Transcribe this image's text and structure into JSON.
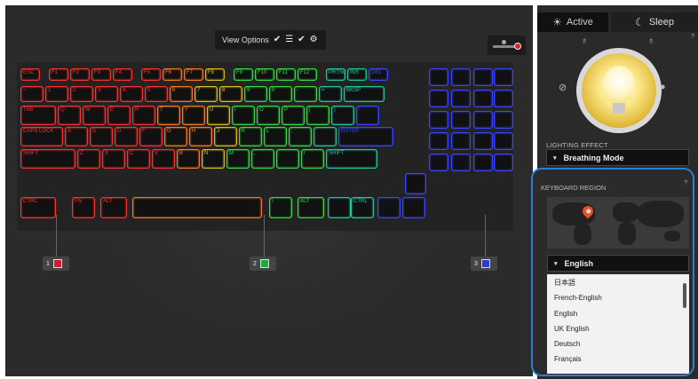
{
  "view_options": {
    "label": "View Options",
    "check1": "✔",
    "list_icon": "☰",
    "check2": "✔",
    "gear_icon": "⚙"
  },
  "tabs": {
    "active": "Active",
    "sleep": "Sleep",
    "sun_icon": "☀",
    "moon_icon": "☾"
  },
  "lighting_effect": {
    "label": "LIGHTING EFFECT",
    "value": "Breathing Mode",
    "arrow": "▾"
  },
  "keyboard_region": {
    "label": "KEYBOARD REGION",
    "help": "?",
    "selected": "English",
    "arrow": "▾",
    "options": [
      "日本語",
      "French-English",
      "English",
      "UK English",
      "Deutsch",
      "Français"
    ]
  },
  "panel_help": "?",
  "zones": [
    {
      "num": "1",
      "color": "#cc1f2e"
    },
    {
      "num": "2",
      "color": "#1faa3a"
    },
    {
      "num": "3",
      "color": "#2c3ccc"
    }
  ],
  "keys": {
    "row1": [
      "ESC",
      "F1",
      "F2",
      "F3",
      "F4",
      "F5",
      "F6",
      "F7",
      "F8",
      "F9",
      "F10",
      "F11",
      "F12",
      "PRTSC",
      "INS",
      "DEL"
    ],
    "tab": "TAB",
    "caps": "CAPS LOCK",
    "shift": "SHIFT",
    "ctrl": "CTRL",
    "fn": "FN",
    "alt": "ALT",
    "enter": "ENTER",
    "letters1": [
      "Q",
      "W",
      "E",
      "R",
      "T",
      "Y",
      "U",
      "I",
      "O",
      "P",
      "[",
      "]",
      "\\"
    ],
    "letters2": [
      "A",
      "S",
      "D",
      "F",
      "G",
      "H",
      "J",
      "K",
      "L",
      ";",
      "'"
    ],
    "letters3": [
      "Z",
      "X",
      "C",
      "V",
      "B",
      "N",
      "M",
      ",",
      ".",
      "/"
    ],
    "nums": [
      "~",
      "1",
      "2",
      "3",
      "4",
      "5",
      "6",
      "7",
      "8",
      "9",
      "0",
      "-",
      "="
    ]
  }
}
